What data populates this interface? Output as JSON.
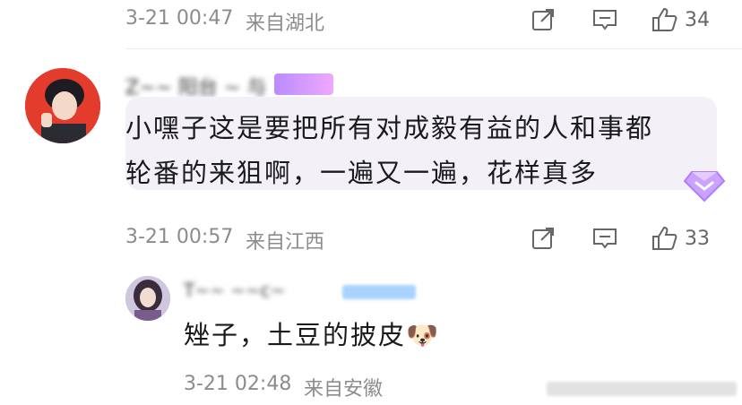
{
  "comment_top": {
    "time": "3-21 00:47",
    "location": "来自湖北",
    "likes": "34"
  },
  "comment_main": {
    "username": "Z~~ 阳台 ~ 与",
    "content_line1": "小嘿子这是要把所有对成毅有益的人和事都",
    "content_line2": "轮番的来狙啊，一遍又一遍，花样真多",
    "time": "3-21 00:57",
    "location": "来自江西",
    "likes": "33"
  },
  "reply": {
    "username": "T~~ ~~c~",
    "content": "矬子，土豆的披皮🐶",
    "time": "3-21 02:48",
    "location": "来自安徽"
  },
  "colors": {
    "meta_gray": "#8c8c8c",
    "bubble_bg": "#f3f0f8",
    "vip_purple": "#b98cff"
  },
  "icons": [
    "share-icon",
    "comment-icon",
    "like-thumb-icon",
    "diamond-vip-icon"
  ]
}
